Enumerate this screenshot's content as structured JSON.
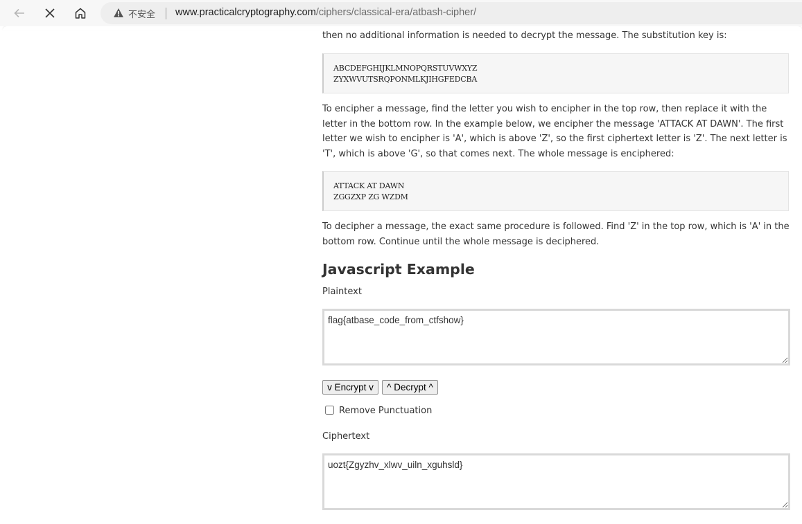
{
  "browser": {
    "security_label": "不安全",
    "url_host": "www.practicalcryptography.com",
    "url_path": "/ciphers/classical-era/atbash-cipher/"
  },
  "article": {
    "intro_text": "then no additional information is needed to decrypt the message. The substitution key is:",
    "key_block": [
      "ABCDEFGHIJKLMNOPQRSTUVWXYZ",
      "ZYXWVUTSRQPONMLKJIHGFEDCBA"
    ],
    "encipher_text": "To encipher a message, find the letter you wish to encipher in the top row, then replace it with the letter in the bottom row. In the example below, we encipher the message 'ATTACK AT DAWN'. The first letter we wish to encipher is 'A', which is above 'Z', so the first ciphertext letter is 'Z'. The next letter is 'T', which is above 'G', so that comes next. The whole message is enciphered:",
    "example_block": [
      "ATTACK AT DAWN",
      "ZGGZXP ZG WZDM"
    ],
    "decipher_text": "To decipher a message, the exact same procedure is followed. Find 'Z' in the top row, which is 'A' in the bottom row. Continue until the whole message is deciphered."
  },
  "js_example": {
    "heading": "Javascript Example",
    "plaintext_label": "Plaintext",
    "plaintext_value": "flag{atbase_code_from_ctfshow}",
    "encrypt_label": "v Encrypt v",
    "decrypt_label": "^ Decrypt ^",
    "remove_punctuation_label": "Remove Punctuation",
    "remove_punctuation_checked": false,
    "ciphertext_label": "Ciphertext",
    "ciphertext_value": "uozt{Zgyzhv_xlwv_uiln_xguhsld}"
  },
  "colors": {
    "text": "#333333",
    "code_background": "#f6f6f6",
    "textarea_border": "#d9d9d9",
    "button_background": "#eeeeee"
  },
  "icons": [
    "back-arrow-icon",
    "stop-icon",
    "home-icon",
    "warning-icon"
  ]
}
